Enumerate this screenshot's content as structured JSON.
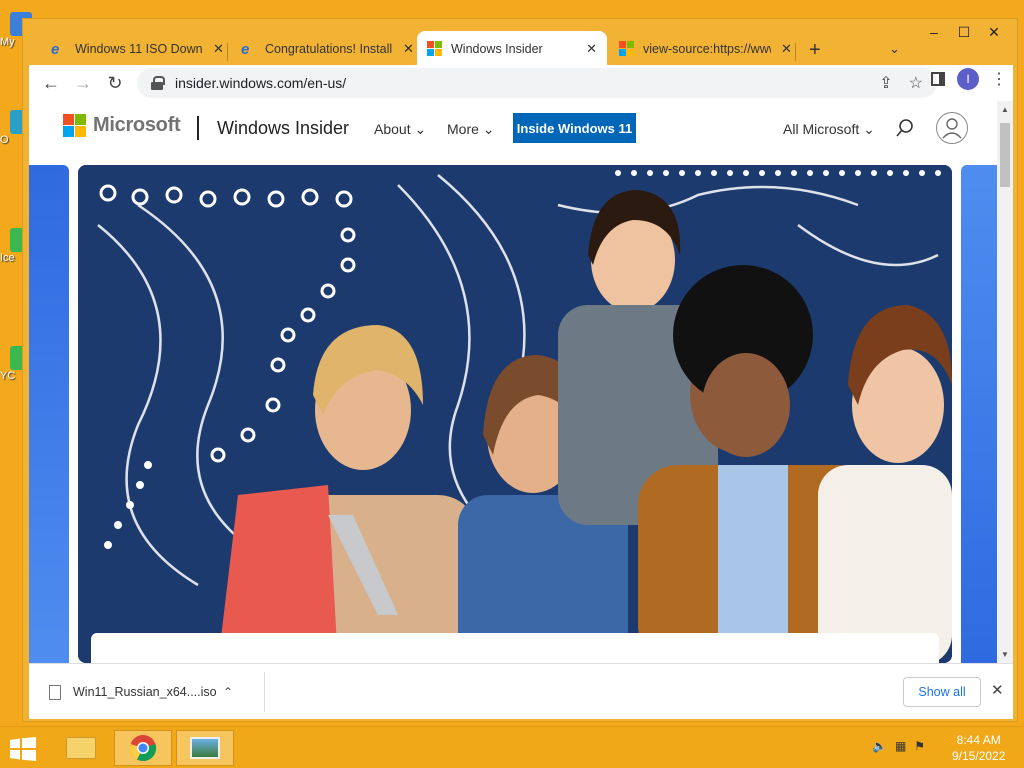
{
  "desktop": {
    "icons": [
      {
        "label": "My",
        "color": "#3c7fd8"
      },
      {
        "label": "O",
        "color": "#2aa0c8"
      },
      {
        "label": "Ice",
        "color": "#3cb850"
      },
      {
        "label": "YC",
        "color": "#3cb850"
      }
    ]
  },
  "browser": {
    "tabs": [
      {
        "title": "Windows 11 ISO Downl",
        "favicon": "edge-icon",
        "active": false
      },
      {
        "title": "Congratulations! Install",
        "favicon": "edge-icon",
        "active": false
      },
      {
        "title": "Windows Insider",
        "favicon": "microsoft-icon",
        "active": true
      },
      {
        "title": "view-source:https://www",
        "favicon": "microsoft-icon",
        "active": false
      }
    ],
    "url": "insider.windows.com/en-us/",
    "profile_initial": "I"
  },
  "page": {
    "brand": "Microsoft",
    "product": "Windows Insider",
    "nav": [
      {
        "label": "About"
      },
      {
        "label": "More"
      }
    ],
    "cta": "Inside Windows 11",
    "all_microsoft": "All Microsoft"
  },
  "downloads": {
    "file_name": "Win11_Russian_x64....iso",
    "show_all": "Show all"
  },
  "taskbar": {
    "time": "8:44 AM",
    "date": "9/15/2022"
  },
  "colors": {
    "ms_red": "#f25022",
    "ms_green": "#7fba00",
    "ms_blue": "#00a4ef",
    "ms_yellow": "#ffb900",
    "accent": "#0067b8"
  }
}
